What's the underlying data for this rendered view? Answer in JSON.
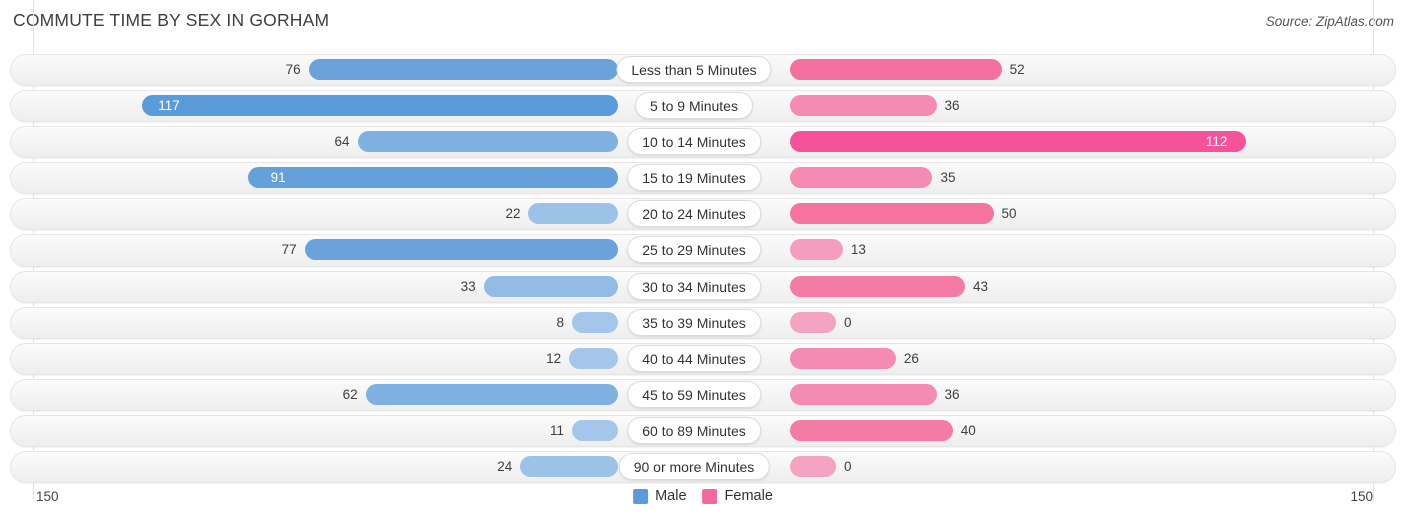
{
  "header": {
    "title": "COMMUTE TIME BY SEX IN GORHAM",
    "source": "Source: ZipAtlas.com"
  },
  "axis": {
    "left_label": "150",
    "right_label": "150",
    "max": 150
  },
  "legend": [
    {
      "label": "Male",
      "color": "#5b9bd9"
    },
    {
      "label": "Female",
      "color": "#f4689f"
    }
  ],
  "colors": {
    "male_dark": "#5b9bd9",
    "male_light": "#a3c6ea",
    "female_dark": "#f4539a",
    "female_mid": "#f4759f",
    "female_light": "#f4a3c1",
    "track": "#f3f3f3",
    "gridline": "#e3e3e3"
  },
  "chart_data": {
    "type": "bar",
    "title": "COMMUTE TIME BY SEX IN GORHAM",
    "subtitle": "Source: ZipAtlas.com",
    "orientation": "horizontal-diverging",
    "xlabel": "",
    "ylabel": "",
    "xlim": [
      -150,
      150
    ],
    "grid": true,
    "legend_position": "bottom-center",
    "categories": [
      "Less than 5 Minutes",
      "5 to 9 Minutes",
      "10 to 14 Minutes",
      "15 to 19 Minutes",
      "20 to 24 Minutes",
      "25 to 29 Minutes",
      "30 to 34 Minutes",
      "35 to 39 Minutes",
      "40 to 44 Minutes",
      "45 to 59 Minutes",
      "60 to 89 Minutes",
      "90 or more Minutes"
    ],
    "series": [
      {
        "name": "Male",
        "values": [
          76,
          117,
          64,
          91,
          22,
          77,
          33,
          8,
          12,
          62,
          11,
          24
        ]
      },
      {
        "name": "Female",
        "values": [
          52,
          36,
          112,
          35,
          50,
          13,
          43,
          0,
          26,
          36,
          40,
          0
        ]
      }
    ]
  },
  "rows": [
    {
      "label": "Less than 5 Minutes",
      "male": 76,
      "female": 52,
      "male_text": "76",
      "female_text": "52",
      "male_inside": false,
      "female_inside": false,
      "male_color": "#6aa3dc",
      "female_color": "#f4709f"
    },
    {
      "label": "5 to 9 Minutes",
      "male": 117,
      "female": 36,
      "male_text": "117",
      "female_text": "36",
      "male_inside": true,
      "female_inside": false,
      "male_color": "#5b9bd9",
      "female_color": "#f48bb2"
    },
    {
      "label": "10 to 14 Minutes",
      "male": 64,
      "female": 112,
      "male_text": "64",
      "female_text": "112",
      "male_inside": false,
      "female_inside": true,
      "male_color": "#7eb0e0",
      "female_color": "#f4539a"
    },
    {
      "label": "15 to 19 Minutes",
      "male": 91,
      "female": 35,
      "male_text": "91",
      "female_text": "35",
      "male_inside": true,
      "female_inside": false,
      "male_color": "#64a0da",
      "female_color": "#f48bb2"
    },
    {
      "label": "20 to 24 Minutes",
      "male": 22,
      "female": 50,
      "male_text": "22",
      "female_text": "50",
      "male_inside": false,
      "female_inside": false,
      "male_color": "#9cc2e8",
      "female_color": "#f4739f"
    },
    {
      "label": "25 to 29 Minutes",
      "male": 77,
      "female": 13,
      "male_text": "77",
      "female_text": "13",
      "male_inside": false,
      "female_inside": false,
      "male_color": "#6aa3dc",
      "female_color": "#f49dbe"
    },
    {
      "label": "30 to 34 Minutes",
      "male": 33,
      "female": 43,
      "male_text": "33",
      "female_text": "43",
      "male_inside": false,
      "female_inside": false,
      "male_color": "#92bce6",
      "female_color": "#f47ba6"
    },
    {
      "label": "35 to 39 Minutes",
      "male": 8,
      "female": 0,
      "male_text": "8",
      "female_text": "0",
      "male_inside": false,
      "female_inside": false,
      "male_color": "#a3c6ea",
      "female_color": "#f4a3c1"
    },
    {
      "label": "40 to 44 Minutes",
      "male": 12,
      "female": 26,
      "male_text": "12",
      "female_text": "26",
      "male_inside": false,
      "female_inside": false,
      "male_color": "#a3c6ea",
      "female_color": "#f48bb2"
    },
    {
      "label": "45 to 59 Minutes",
      "male": 62,
      "female": 36,
      "male_text": "62",
      "female_text": "36",
      "male_inside": false,
      "female_inside": false,
      "male_color": "#7eb0e0",
      "female_color": "#f48bb2"
    },
    {
      "label": "60 to 89 Minutes",
      "male": 11,
      "female": 40,
      "male_text": "11",
      "female_text": "40",
      "male_inside": false,
      "female_inside": false,
      "male_color": "#a3c6ea",
      "female_color": "#f47ba6"
    },
    {
      "label": "90 or more Minutes",
      "male": 24,
      "female": 0,
      "male_text": "24",
      "female_text": "0",
      "male_inside": false,
      "female_inside": false,
      "male_color": "#9cc2e8",
      "female_color": "#f4a3c1"
    }
  ]
}
